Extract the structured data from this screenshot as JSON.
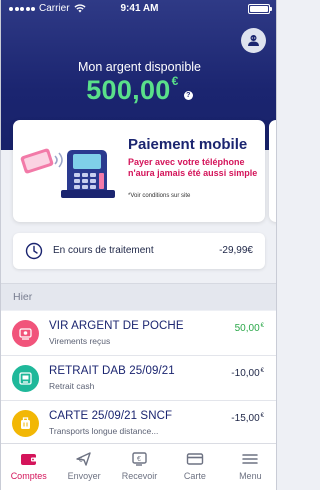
{
  "status": {
    "carrier": "Carrier",
    "time": "9:41 AM"
  },
  "header": {
    "avatar_icon": "user-avatar-icon",
    "balance_label": "Mon argent disponible",
    "balance_amount": "500,00",
    "currency": "€",
    "info_symbol": "?"
  },
  "promo": {
    "title": "Paiement mobile",
    "text": "Payer avec votre téléphone n'aura jamais été aussi simple",
    "note": "*Voir conditions sur site"
  },
  "pending": {
    "label": "En cours de traitement",
    "amount": "-29,99€"
  },
  "transactions": {
    "section_label": "Hier",
    "items": [
      {
        "title": "VIR ARGENT DE POCHE",
        "subtitle": "Virements reçus",
        "amount": "50,00",
        "currency": "€",
        "amount_color": "#2ba84a",
        "icon": "transfer-icon",
        "icon_bg": "#f1547b"
      },
      {
        "title": "RETRAIT DAB 25/09/21",
        "subtitle": "Retrait cash",
        "amount": "-10,00",
        "currency": "€",
        "amount_color": "#1d2546",
        "icon": "atm-icon",
        "icon_bg": "#1fb89a"
      },
      {
        "title": "CARTE 25/09/21 SNCF",
        "subtitle": "Transports longue distance...",
        "amount": "-15,00",
        "currency": "€",
        "amount_color": "#1d2546",
        "icon": "luggage-icon",
        "icon_bg": "#f2b705"
      }
    ]
  },
  "tabs": [
    {
      "label": "Comptes",
      "icon": "wallet-icon",
      "active": true
    },
    {
      "label": "Envoyer",
      "icon": "send-money-icon",
      "active": false
    },
    {
      "label": "Recevoir",
      "icon": "receive-money-icon",
      "active": false
    },
    {
      "label": "Carte",
      "icon": "card-icon",
      "active": false
    },
    {
      "label": "Menu",
      "icon": "hamburger-menu-icon",
      "active": false
    }
  ],
  "colors": {
    "brand_navy": "#1b2570",
    "accent_pink": "#d4145a",
    "balance_green": "#5ae08a"
  }
}
